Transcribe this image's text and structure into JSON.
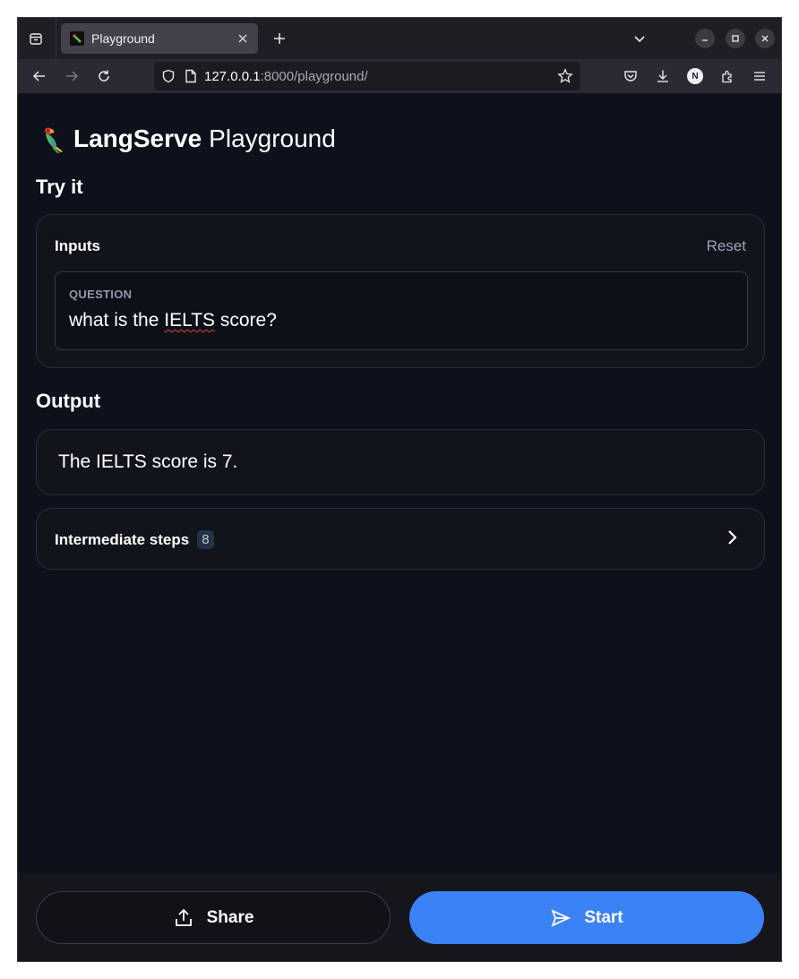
{
  "browser": {
    "tab_title": "Playground",
    "url_host": "127.0.0.1",
    "url_rest": ":8000/playground/",
    "icons": [
      "sidebar-icon",
      "close-icon",
      "plus-icon",
      "chevron-down-icon",
      "minimize-icon",
      "maximize-icon",
      "back-icon",
      "forward-icon",
      "reload-icon",
      "shield-icon",
      "page-icon",
      "star-icon",
      "pocket-icon",
      "download-icon",
      "profile-icon",
      "extensions-icon",
      "menu-icon"
    ],
    "profile_initial": "N"
  },
  "app": {
    "title_bold": "LangServe",
    "title_rest": "Playground"
  },
  "try_it": {
    "heading": "Try it",
    "inputs_label": "Inputs",
    "reset_label": "Reset",
    "field_label": "QUESTION",
    "field_value_prefix": "what is the ",
    "field_value_misspelled": "IELTS",
    "field_value_suffix": " score?"
  },
  "output": {
    "heading": "Output",
    "text": "The IELTS score is 7.",
    "steps_label": "Intermediate steps",
    "steps_count": "8"
  },
  "actions": {
    "share_label": "Share",
    "start_label": "Start"
  },
  "colors": {
    "background": "#0d111b",
    "primary": "#3b82f6",
    "card": "#12141b"
  }
}
